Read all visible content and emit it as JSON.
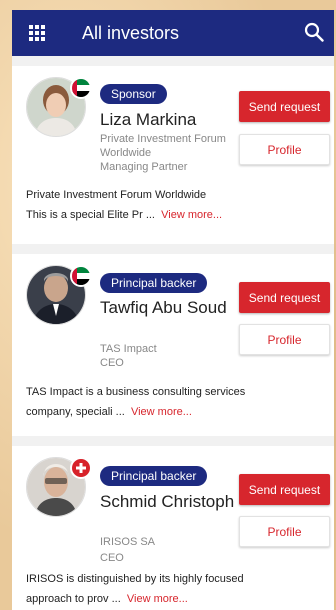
{
  "header": {
    "title": "All investors",
    "menu_icon": "grid-menu-icon",
    "search_icon": "search-icon"
  },
  "investors": [
    {
      "role": "Sponsor",
      "name": "Liza Markina",
      "org": "Private Investment Forum Worldwide",
      "position": "Managing Partner",
      "desc_line1": "Private Investment Forum Worldwide",
      "desc_line2": "This is a special Elite Pr ...",
      "view_more": "View more...",
      "send_label": "Send request",
      "profile_label": "Profile",
      "badge": "uae-flag-icon"
    },
    {
      "role": "Principal backer",
      "name": "Tawfiq Abu Soud",
      "org": "TAS Impact",
      "position": "CEO",
      "desc_line1": "TAS Impact is a business consulting services",
      "desc_line2": "company, speciali ...",
      "view_more": "View more...",
      "send_label": "Send request",
      "profile_label": "Profile",
      "badge": "uae-flag-icon"
    },
    {
      "role": "Principal backer",
      "name": "Schmid Christoph",
      "org": "IRISOS SA",
      "position": "CEO",
      "desc_line1": "IRISOS is distinguished by its highly focused",
      "desc_line2": "approach to prov ...",
      "view_more": "View more...",
      "send_label": "Send request",
      "profile_label": "Profile",
      "badge": "swiss-cross-icon"
    }
  ],
  "colors": {
    "appbar": "#1d2a80",
    "badge": "#1d2a80",
    "accent_red": "#d7262d",
    "card": "#ffffff"
  }
}
